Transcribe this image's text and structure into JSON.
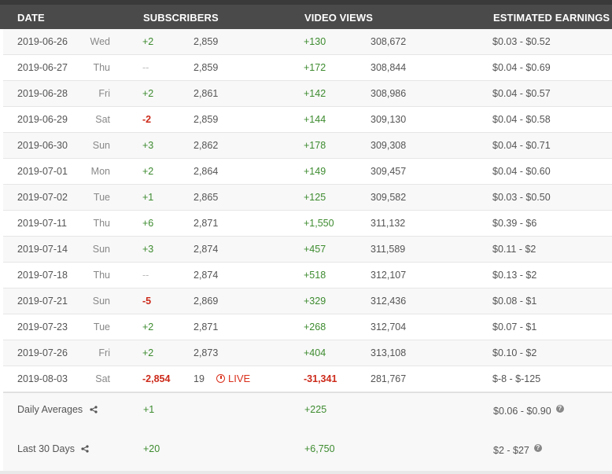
{
  "header": {
    "date": "DATE",
    "subscribers": "SUBSCRIBERS",
    "video_views": "VIDEO VIEWS",
    "earnings": "ESTIMATED EARNINGS"
  },
  "rows": [
    {
      "date": "2019-06-26",
      "day": "Wed",
      "sub_change": "+2",
      "sub_total": "2,859",
      "view_change": "+130",
      "view_total": "308,672",
      "earnings": "$0.03  -  $0.52"
    },
    {
      "date": "2019-06-27",
      "day": "Thu",
      "sub_change": "--",
      "sub_total": "2,859",
      "view_change": "+172",
      "view_total": "308,844",
      "earnings": "$0.04  -  $0.69"
    },
    {
      "date": "2019-06-28",
      "day": "Fri",
      "sub_change": "+2",
      "sub_total": "2,861",
      "view_change": "+142",
      "view_total": "308,986",
      "earnings": "$0.04  -  $0.57"
    },
    {
      "date": "2019-06-29",
      "day": "Sat",
      "sub_change": "-2",
      "sub_total": "2,859",
      "view_change": "+144",
      "view_total": "309,130",
      "earnings": "$0.04  -  $0.58"
    },
    {
      "date": "2019-06-30",
      "day": "Sun",
      "sub_change": "+3",
      "sub_total": "2,862",
      "view_change": "+178",
      "view_total": "309,308",
      "earnings": "$0.04  -  $0.71"
    },
    {
      "date": "2019-07-01",
      "day": "Mon",
      "sub_change": "+2",
      "sub_total": "2,864",
      "view_change": "+149",
      "view_total": "309,457",
      "earnings": "$0.04  -  $0.60"
    },
    {
      "date": "2019-07-02",
      "day": "Tue",
      "sub_change": "+1",
      "sub_total": "2,865",
      "view_change": "+125",
      "view_total": "309,582",
      "earnings": "$0.03  -  $0.50"
    },
    {
      "date": "2019-07-11",
      "day": "Thu",
      "sub_change": "+6",
      "sub_total": "2,871",
      "view_change": "+1,550",
      "view_total": "311,132",
      "earnings": "$0.39  -  $6"
    },
    {
      "date": "2019-07-14",
      "day": "Sun",
      "sub_change": "+3",
      "sub_total": "2,874",
      "view_change": "+457",
      "view_total": "311,589",
      "earnings": "$0.11  -  $2"
    },
    {
      "date": "2019-07-18",
      "day": "Thu",
      "sub_change": "--",
      "sub_total": "2,874",
      "view_change": "+518",
      "view_total": "312,107",
      "earnings": "$0.13  -  $2"
    },
    {
      "date": "2019-07-21",
      "day": "Sun",
      "sub_change": "-5",
      "sub_total": "2,869",
      "view_change": "+329",
      "view_total": "312,436",
      "earnings": "$0.08  -  $1"
    },
    {
      "date": "2019-07-23",
      "day": "Tue",
      "sub_change": "+2",
      "sub_total": "2,871",
      "view_change": "+268",
      "view_total": "312,704",
      "earnings": "$0.07  -  $1"
    },
    {
      "date": "2019-07-26",
      "day": "Fri",
      "sub_change": "+2",
      "sub_total": "2,873",
      "view_change": "+404",
      "view_total": "313,108",
      "earnings": "$0.10  -  $2"
    },
    {
      "date": "2019-08-03",
      "day": "Sat",
      "sub_change": "-2,854",
      "sub_total": "19",
      "live": "LIVE",
      "view_change": "-31,341",
      "view_total": "281,767",
      "earnings": "$-8  -  $-125"
    }
  ],
  "summary": {
    "daily": {
      "label": "Daily Averages",
      "sub": "+1",
      "views": "+225",
      "earnings": "$0.06  -  $0.90"
    },
    "last30": {
      "label": "Last 30 Days",
      "sub": "+20",
      "views": "+6,750",
      "earnings": "$2  -  $27"
    }
  },
  "icons": {
    "share": "share-icon",
    "help": "help-icon",
    "live": "clock-icon"
  },
  "colors": {
    "positive": "#3d8b2f",
    "negative": "#cc2a1a",
    "header_bg": "#4a4a4a",
    "live": "#d9301c"
  }
}
